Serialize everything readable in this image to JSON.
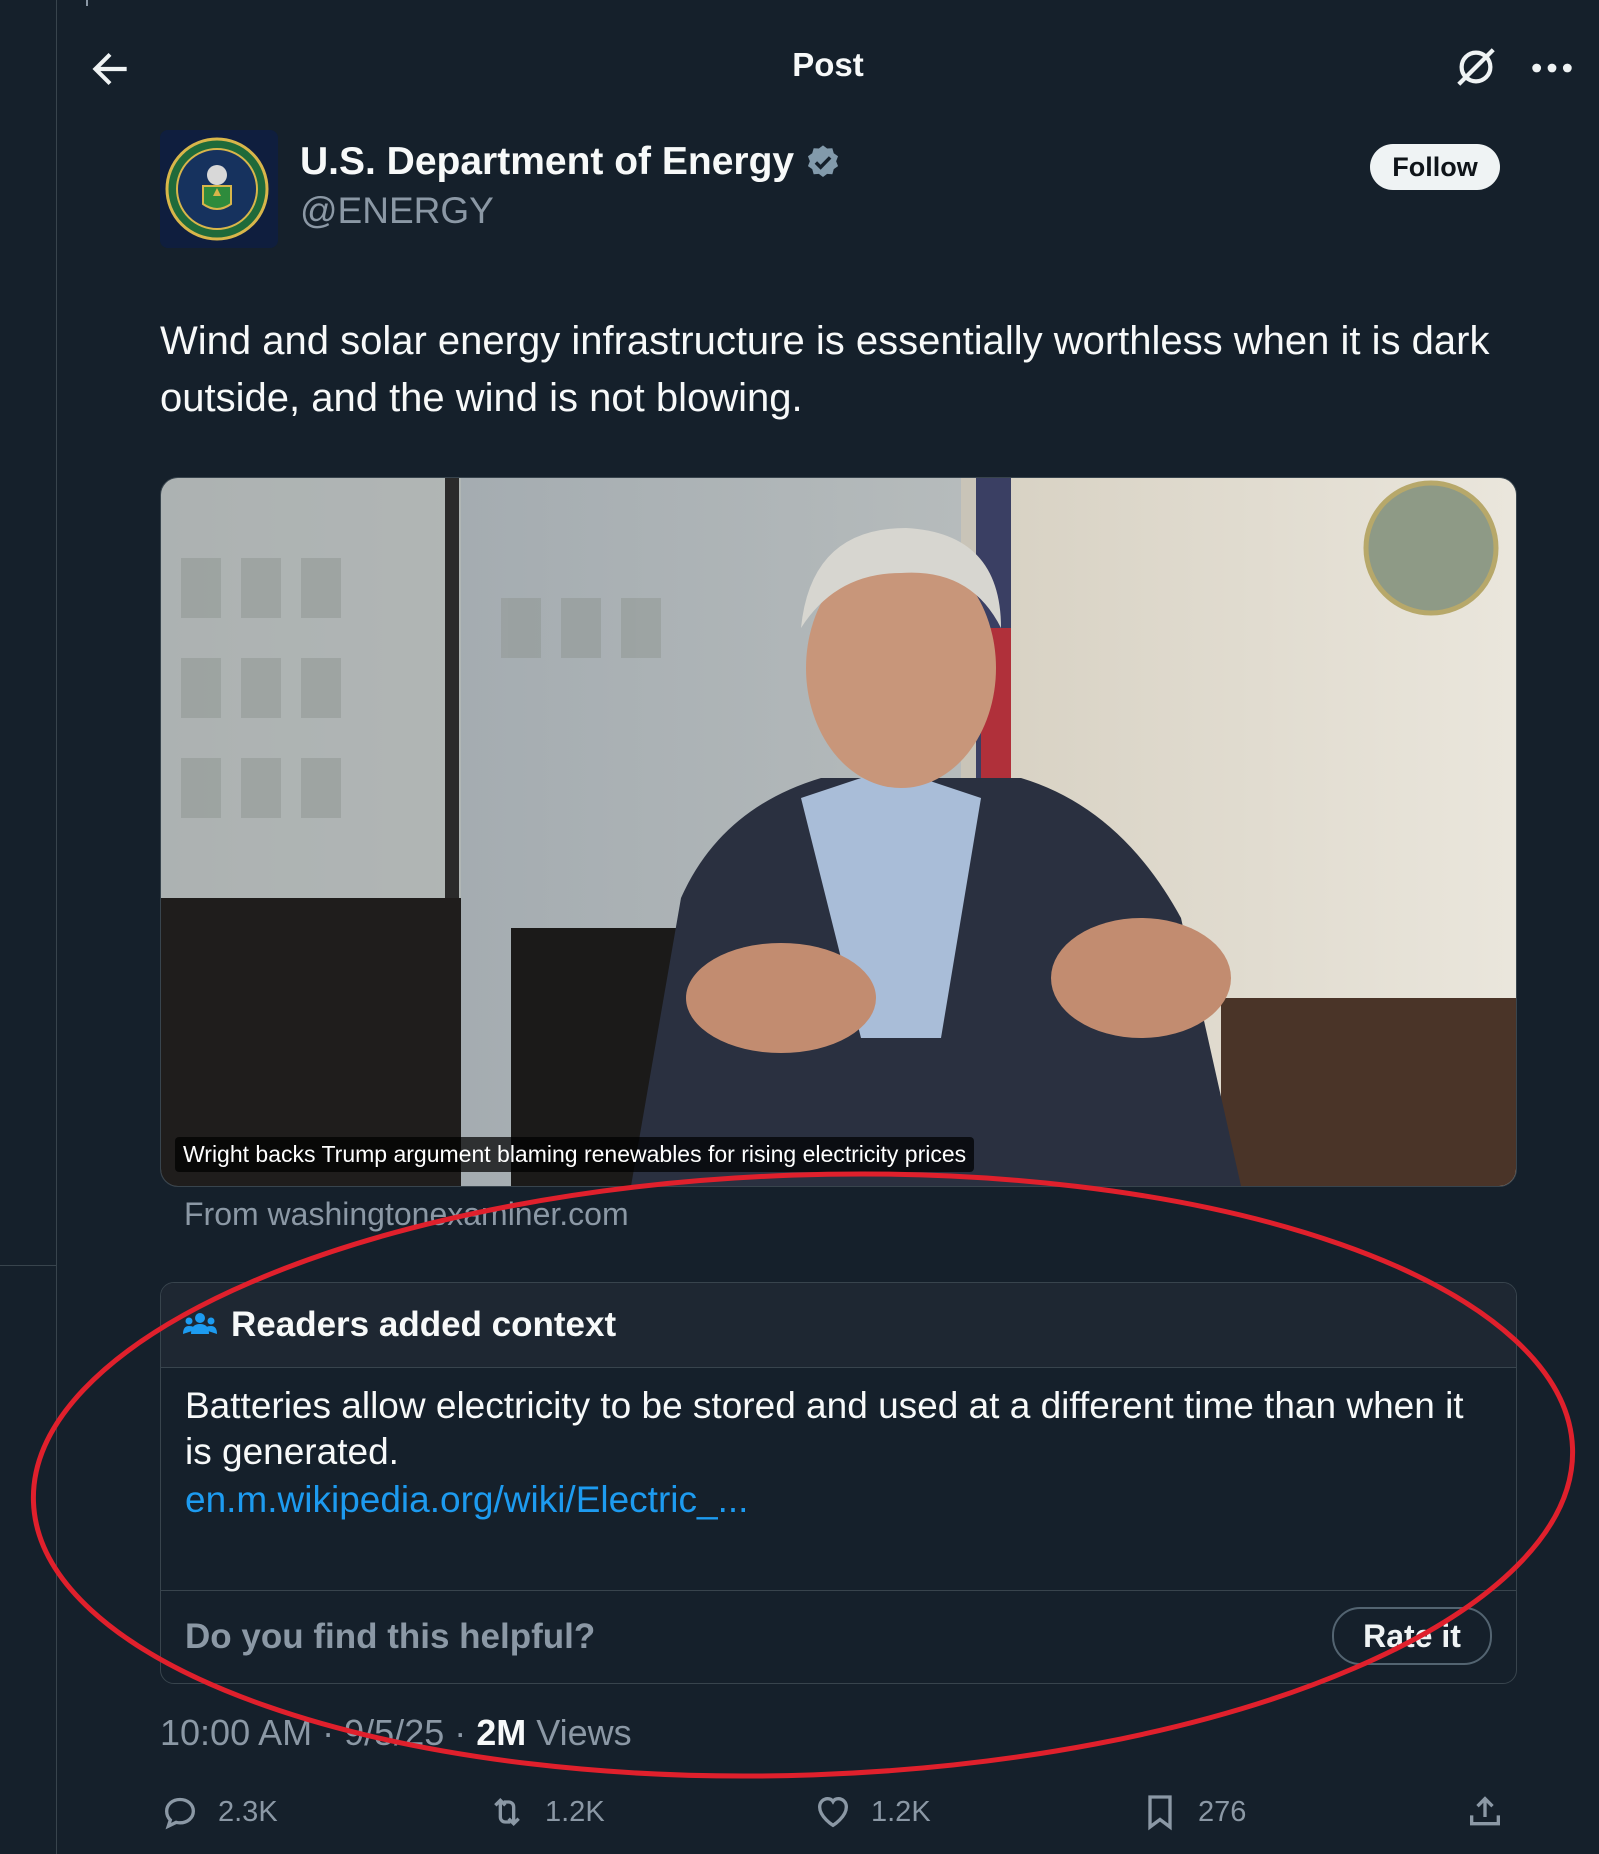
{
  "header": {
    "title": "Post"
  },
  "author": {
    "name": "U.S. Department of Energy",
    "handle": "@ENERGY",
    "follow_label": "Follow"
  },
  "tweet": {
    "text": "Wind and solar energy infrastructure is essentially worthless when it is dark outside, and the wind is not blowing."
  },
  "media": {
    "caption": "Wright backs Trump argument blaming renewables for rising electricity prices",
    "source": "From washingtonexaminer.com"
  },
  "note": {
    "title": "Readers added context",
    "body": "Batteries allow electricity to be stored and used at a different time than when it is generated.",
    "link": "en.m.wikipedia.org/wiki/Electric_...",
    "helpful_question": "Do you find this helpful?",
    "rate_label": "Rate it"
  },
  "meta": {
    "time": "10:00 AM",
    "date": "9/5/25",
    "separator": "·",
    "views_count": "2M",
    "views_label": "Views"
  },
  "actions": {
    "replies": "2.3K",
    "reposts": "1.2K",
    "likes": "1.2K",
    "bookmarks": "276"
  },
  "colors": {
    "background": "#15202b",
    "accent": "#1d9bf0",
    "secondary_text": "#8b98a5",
    "annotation": "#e0202c"
  }
}
